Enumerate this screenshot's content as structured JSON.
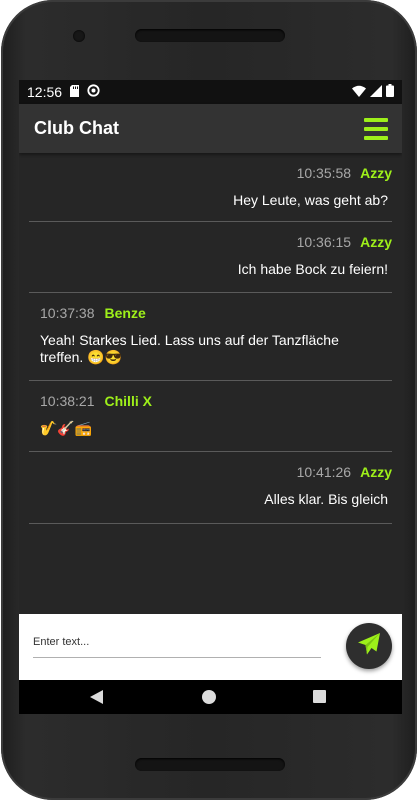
{
  "status_bar": {
    "time": "12:56",
    "left_icons": [
      "sd-card-icon",
      "sync-icon"
    ],
    "right_icons": [
      "wifi-icon",
      "signal-icon",
      "battery-icon"
    ]
  },
  "app": {
    "title": "Club Chat",
    "menu_icon": "hamburger-menu-icon",
    "accent_color": "#9ef01a"
  },
  "messages": [
    {
      "align": "right",
      "time": "10:35:58",
      "user": "Azzy",
      "text": "Hey Leute, was geht ab?"
    },
    {
      "align": "right",
      "time": "10:36:15",
      "user": "Azzy",
      "text": "Ich habe Bock zu feiern!"
    },
    {
      "align": "left",
      "time": "10:37:38",
      "user": "Benze",
      "text": "Yeah! Starkes Lied. Lass uns auf der Tanzfläche treffen. 😁😎"
    },
    {
      "align": "left",
      "time": "10:38:21",
      "user": "Chilli X",
      "text": "🎷🎸📻"
    },
    {
      "align": "right",
      "time": "10:41:26",
      "user": "Azzy",
      "text": "Alles klar. Bis gleich"
    }
  ],
  "composer": {
    "placeholder": "Enter text...",
    "value": "",
    "send_icon": "send-icon"
  },
  "nav": {
    "back_icon": "back-icon",
    "home_icon": "home-icon",
    "recents_icon": "recents-icon"
  }
}
